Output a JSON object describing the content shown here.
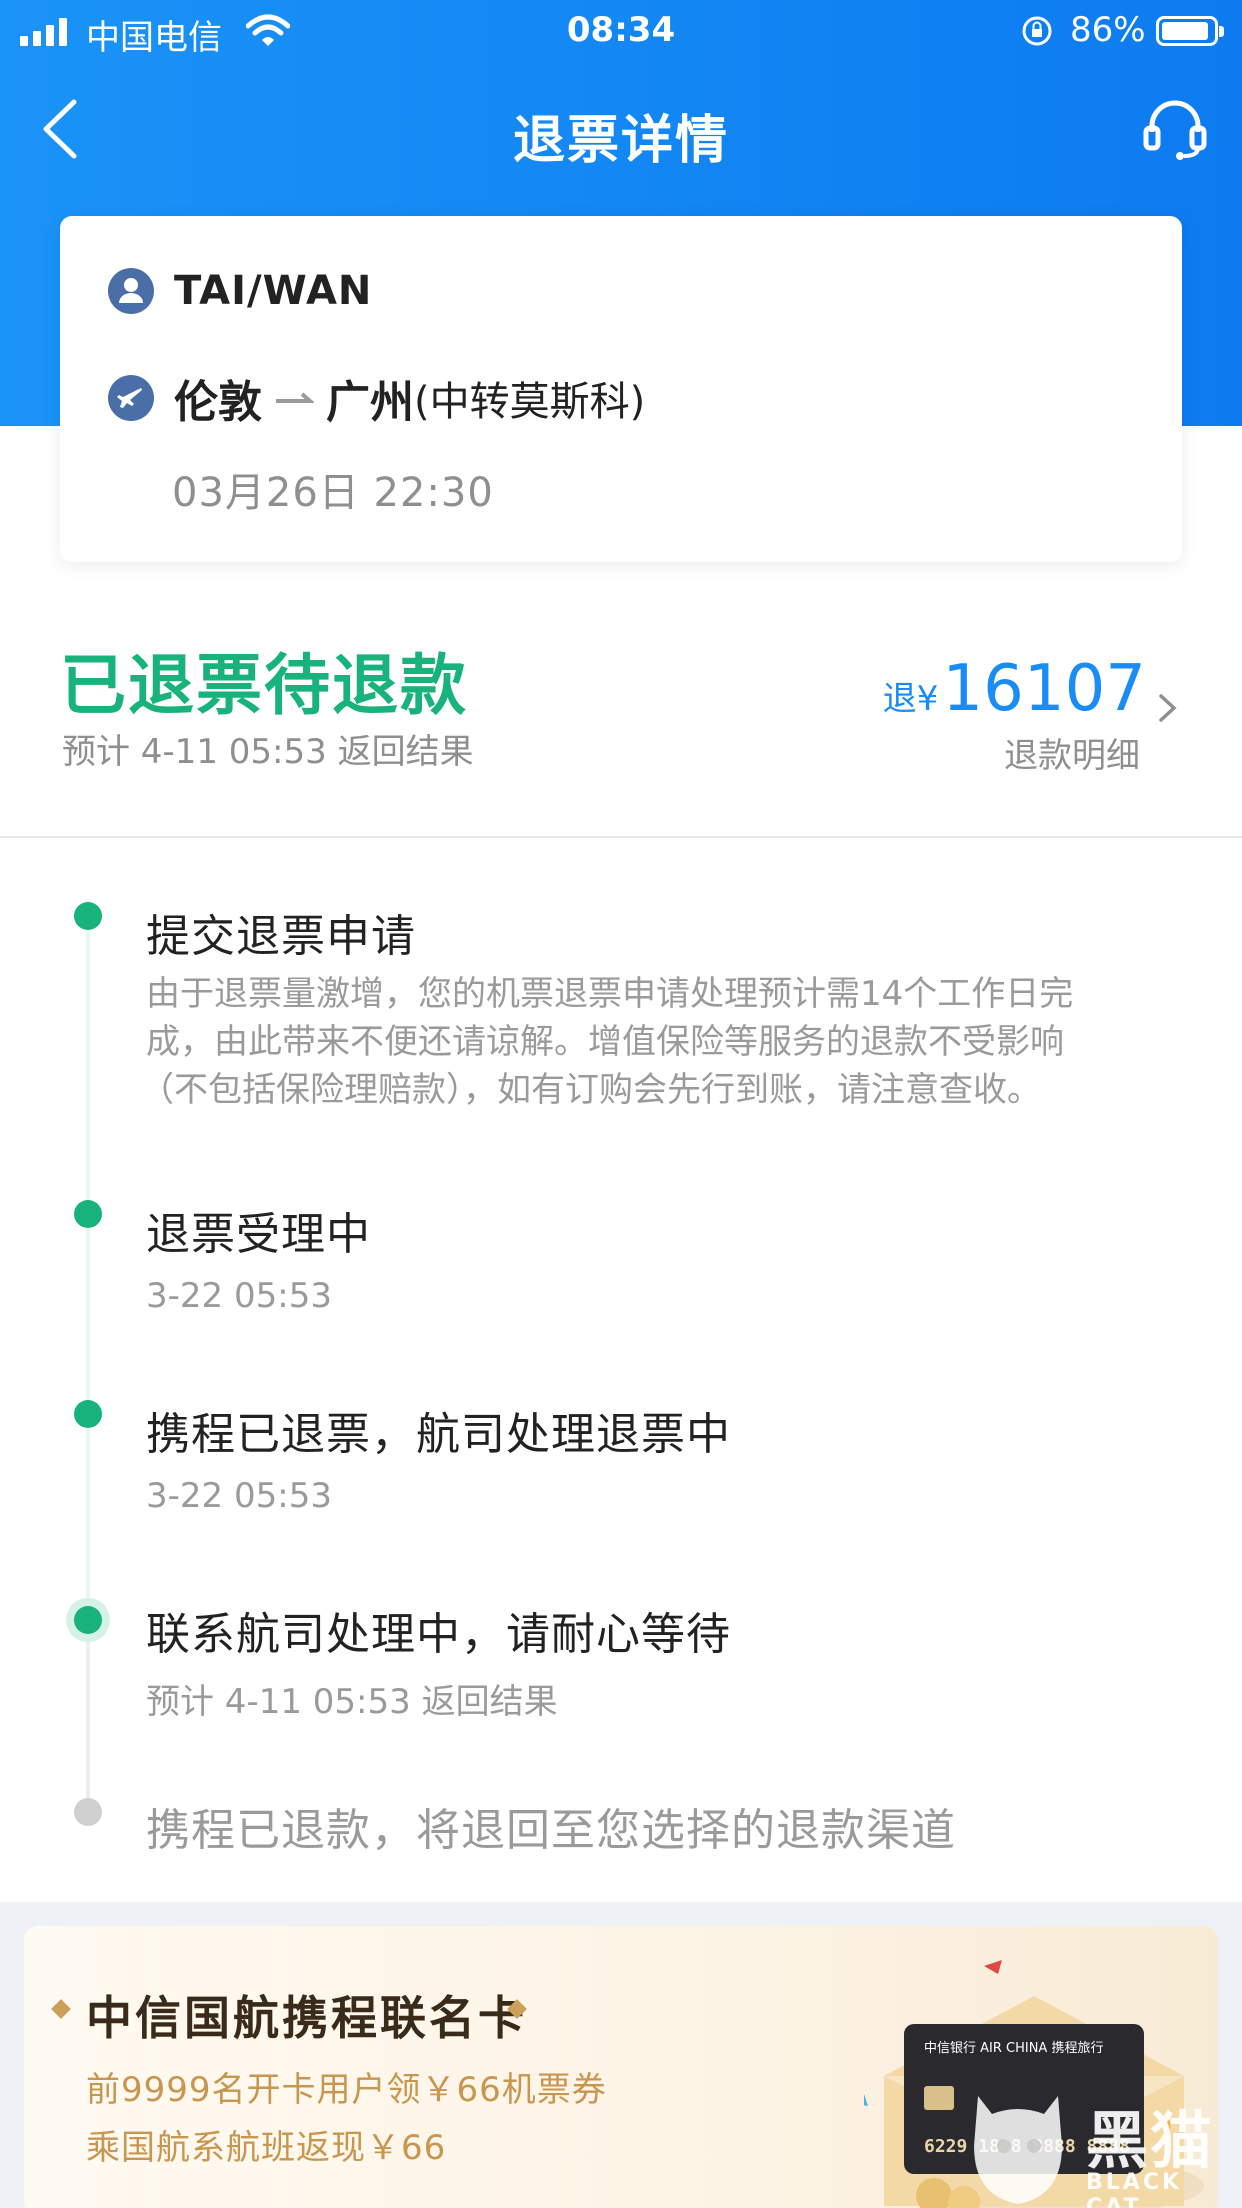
{
  "status_bar": {
    "carrier": "中国电信",
    "time": "08:34",
    "battery": "86%"
  },
  "nav": {
    "title": "退票详情",
    "back_icon": "chevron-left-icon",
    "service_icon": "headset-icon"
  },
  "flight": {
    "passenger": "TAI/WAN",
    "from": "伦敦",
    "to": "广州",
    "via": "(中转莫斯科)",
    "datetime": "03月26日 22:30"
  },
  "refund": {
    "status": "已退票待退款",
    "eta": "预计 4-11 05:53 返回结果",
    "prefix": "退",
    "currency": "¥",
    "amount": "16107",
    "detail_link": "退款明细"
  },
  "timeline": [
    {
      "title": "提交退票申请",
      "desc_lines": [
        "由于退票量激增，您的机票退票申请处理预计需14个工作日完",
        "成，由此带来不便还请谅解。增值保险等服务的退款不受影响",
        "（不包括保险理赔款），如有订购会先行到账，请注意查收。"
      ],
      "state": "done"
    },
    {
      "title": "退票受理中",
      "sub": "3-22 05:53",
      "state": "done"
    },
    {
      "title": "携程已退票，航司处理退票中",
      "sub": "3-22 05:53",
      "state": "done"
    },
    {
      "title": "联系航司处理中，请耐心等待",
      "sub": "预计 4-11 05:53 返回结果",
      "state": "current"
    },
    {
      "title": "携程已退款，将退回至您选择的退款渠道",
      "state": "pending"
    }
  ],
  "promo": {
    "title": "中信国航携程联名卡",
    "line1": "前9999名开卡用户领￥66机票券",
    "line2": "乘国航系航班返现￥66",
    "card_number": "6229 1888 8888 8888"
  },
  "watermark": {
    "text": "黑猫",
    "sub": "BLACK CAT"
  },
  "colors": {
    "header_blue": "#1a93f7",
    "status_green": "#18b27b",
    "amount_blue": "#1a8cf6",
    "promo_gold": "#c8964f"
  }
}
